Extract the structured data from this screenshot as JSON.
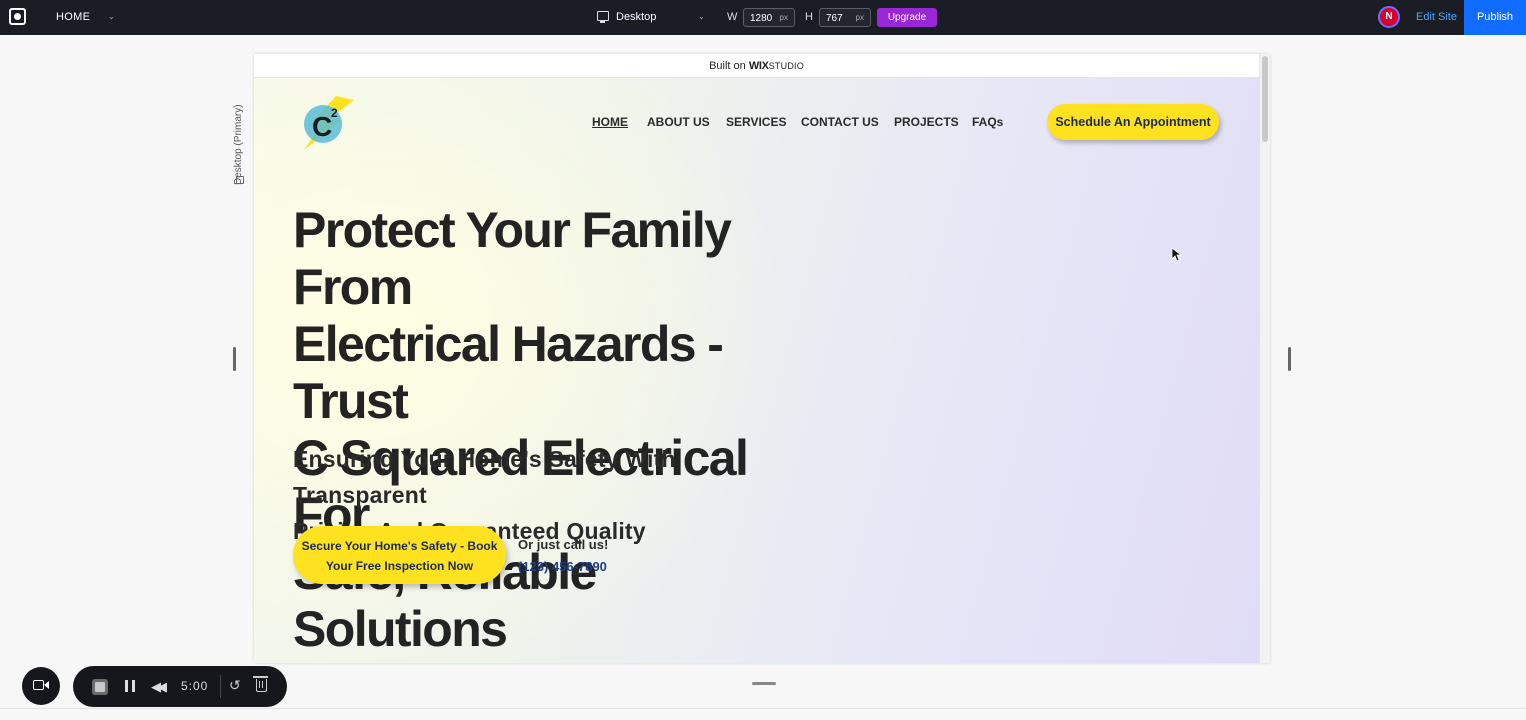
{
  "topbar": {
    "page_name": "HOME",
    "device": "Desktop",
    "width_label": "W",
    "width_value": "1280",
    "height_label": "H",
    "height_value": "767",
    "unit": "px",
    "upgrade_label": "Upgrade",
    "avatar_initial": "N",
    "edit_site_label": "Edit Site",
    "publish_label": "Publish"
  },
  "side_label": "Desktop (Primary)",
  "canvas": {
    "built_prefix": "Built on",
    "built_wix": "WIX",
    "built_studio": "STUDIO"
  },
  "site": {
    "brand_letter": "C",
    "brand_exponent": "2",
    "nav": [
      "HOME",
      "ABOUT US",
      "SERVICES",
      "CONTACT US",
      "PROJECTS",
      "FAQs"
    ],
    "cta_top": "Schedule An Appointment",
    "headline": [
      "Protect Your Family From",
      "Electrical Hazards - Trust",
      "C Squared Electrical For",
      "Safe, Reliable Solutions"
    ],
    "subhead": [
      "Ensuring Your Home's Safety With Transparent",
      "Pricing And Guaranteed Quality"
    ],
    "cta_main": [
      "Secure Your Home's Safety - Book",
      "Your Free Inspection Now"
    ],
    "call_text": "Or just call us!",
    "phone": "(123) 456-7890"
  },
  "recorder": {
    "time": "5:00"
  },
  "colors": {
    "topbar_bg": "#1b1d24",
    "publish_blue": "#116dff",
    "upgrade_purple": "#9a27d5",
    "cta_yellow": "#ffe21f",
    "phone_blue": "#1d3f87"
  },
  "icons": [
    "wix-logo-icon",
    "chevron-down-icon",
    "desktop-icon",
    "camera-icon",
    "stop-icon",
    "pause-icon",
    "rewind-icon",
    "undo-icon",
    "trash-icon",
    "cursor-icon"
  ]
}
